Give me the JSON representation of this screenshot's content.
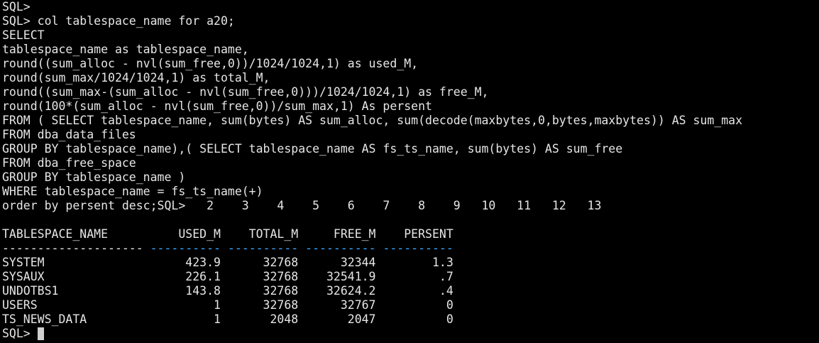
{
  "terminal": {
    "lines": [
      "SQL>",
      "SQL> col tablespace_name for a20;",
      "SELECT",
      "tablespace_name as tablespace_name,",
      "round((sum_alloc - nvl(sum_free,0))/1024/1024,1) as used_M,",
      "round(sum_max/1024/1024,1) as total_M,",
      "round((sum_max-(sum_alloc - nvl(sum_free,0)))/1024/1024,1) as free_M,",
      "round(100*(sum_alloc - nvl(sum_free,0))/sum_max,1) As persent",
      "FROM ( SELECT tablespace_name, sum(bytes) AS sum_alloc, sum(decode(maxbytes,0,bytes,maxbytes)) AS sum_max",
      "FROM dba_data_files",
      "GROUP BY tablespace_name),( SELECT tablespace_name AS fs_ts_name, sum(bytes) AS sum_free",
      "FROM dba_free_space",
      "GROUP BY tablespace_name )",
      "WHERE tablespace_name = fs_ts_name(+)",
      "order by persent desc;SQL>   2    3    4    5    6    7    8    9   10   11   12   13"
    ],
    "blank_line": "",
    "result": {
      "header": "TABLESPACE_NAME          USED_M    TOTAL_M     FREE_M    PERSENT",
      "separator_first": "-------------------- ",
      "separator_rest": "---------- ---------- ---------- ----------",
      "rows": [
        "SYSTEM                    423.9      32768      32344        1.3",
        "SYSAUX                    226.1      32768    32541.9         .7",
        "UNDOTBS1                  143.8      32768    32624.2         .4",
        "USERS                         1      32768      32767          0",
        "TS_NEWS_DATA                  1       2048       2047          0"
      ]
    },
    "prompt": "SQL> "
  },
  "colors": {
    "background": "#000000",
    "text": "#e6e6e6",
    "separator_accent": "#3aa7ff"
  }
}
